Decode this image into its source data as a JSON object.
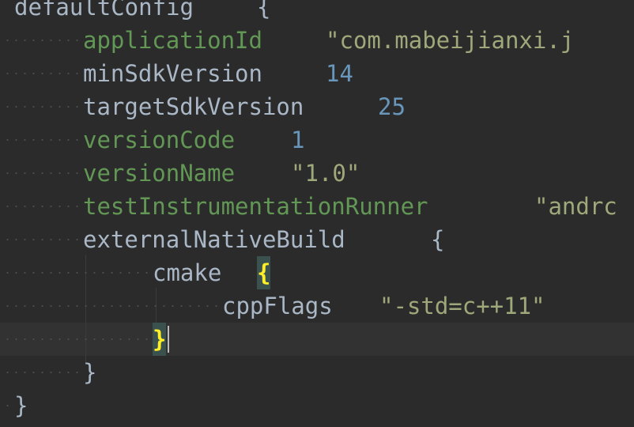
{
  "lines": {
    "l0": {
      "name": "defaultConfig",
      "brace": "{"
    },
    "l1": {
      "key": "applicationId",
      "value": "\"com.mabeijianxi.j"
    },
    "l2": {
      "key": "minSdkVersion",
      "value": "14"
    },
    "l3": {
      "key": "targetSdkVersion",
      "value": "25"
    },
    "l4": {
      "key": "versionCode",
      "value": "1"
    },
    "l5": {
      "key": "versionName",
      "value": "\"1.0\""
    },
    "l6": {
      "key": "testInstrumentationRunner",
      "value": "\"andrc"
    },
    "l7": {
      "name": "externalNativeBuild",
      "brace": "{"
    },
    "l8": {
      "name": "cmake",
      "brace": "{"
    },
    "l9": {
      "key": "cppFlags",
      "value": "\"-std=c++11\""
    },
    "l10": {
      "brace": "}"
    },
    "l11": {
      "brace": "}"
    },
    "l12": {
      "brace": "}"
    }
  },
  "colors": {
    "background": "#2b2b2b",
    "current_line": "#323232",
    "green_keyword": "#629755",
    "plain_identifier": "#a9b7c6",
    "number": "#6897bb",
    "string": "#9fa87a",
    "matched_brace": "#ffef28",
    "matched_brace_bg": "#3b514d"
  }
}
